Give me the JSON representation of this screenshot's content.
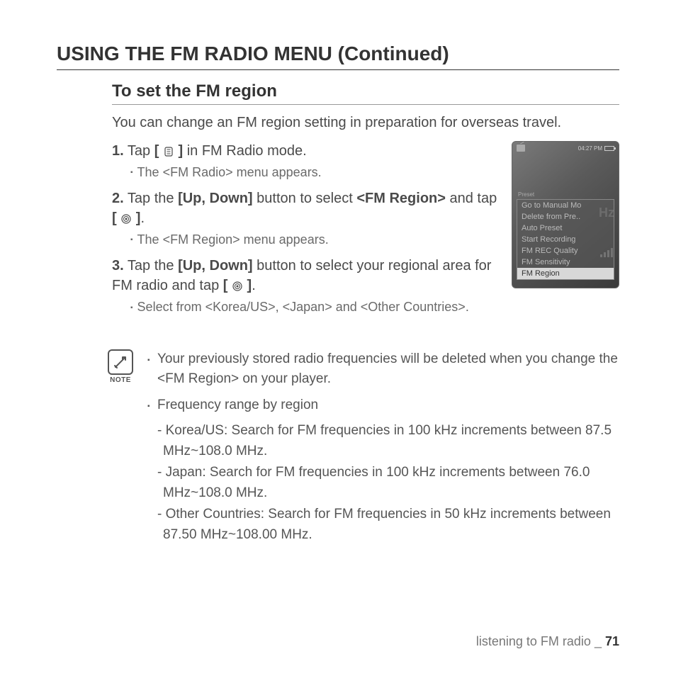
{
  "page_title": "USING THE FM RADIO MENU (Continued)",
  "section_title": "To set the FM region",
  "intro": "You can change an FM region setting in preparation for overseas travel.",
  "steps": {
    "s1": {
      "num": "1.",
      "pre": "Tap ",
      "bold1": "[ ",
      "bold2": " ]",
      "post": " in FM Radio mode.",
      "sub": "The <FM Radio> menu appears."
    },
    "s2": {
      "num": "2.",
      "t1": "Tap the ",
      "b1": "[Up, Down]",
      "t2": " button to select ",
      "b2": "<FM Region>",
      "t3": " and tap ",
      "b3a": "[ ",
      "b3b": " ]",
      "t4": ".",
      "sub": "The <FM Region> menu appears."
    },
    "s3": {
      "num": "3.",
      "t1": "Tap the ",
      "b1": "[Up, Down]",
      "t2": " button to select your regional area for FM radio and tap ",
      "b2a": "[ ",
      "b2b": " ]",
      "t3": ".",
      "sub": "Select from <Korea/US>, <Japan> and <Other Countries>."
    }
  },
  "device": {
    "time": "04:27 PM",
    "preset_label": "Preset",
    "hz": "Hz",
    "menu": [
      {
        "label": "Go to Manual Mo",
        "selected": false
      },
      {
        "label": "Delete from Pre..",
        "selected": false
      },
      {
        "label": "Auto Preset",
        "selected": false
      },
      {
        "label": "Start Recording",
        "selected": false
      },
      {
        "label": "FM REC Quality",
        "selected": false
      },
      {
        "label": "FM Sensitivity",
        "selected": false
      },
      {
        "label": "FM Region",
        "selected": true
      }
    ]
  },
  "note": {
    "label": "NOTE",
    "n1": "Your previously stored radio frequencies will be deleted when you change the <FM Region> on your player.",
    "n2": "Frequency range by region",
    "regions": {
      "r1": "- Korea/US: Search for FM frequencies in 100 kHz increments between 87.5 MHz~108.0 MHz.",
      "r2": "- Japan: Search for FM frequencies in 100 kHz increments between 76.0 MHz~108.0 MHz.",
      "r3": "- Other Countries: Search for FM frequencies in 50 kHz increments between 87.50 MHz~108.00 MHz."
    }
  },
  "footer": {
    "text": "listening to FM radio _ ",
    "page": "71"
  }
}
